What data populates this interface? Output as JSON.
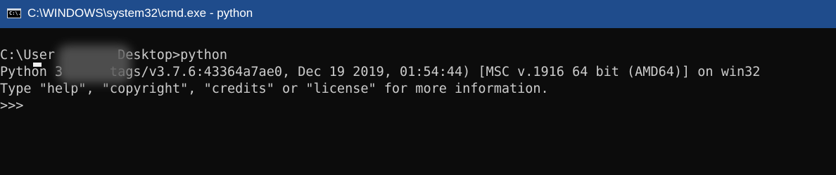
{
  "window": {
    "title": "C:\\WINDOWS\\system32\\cmd.exe - python",
    "icon_name": "cmd-icon",
    "icon_text": "C:\\.",
    "titlebar_color": "#1f4c8c",
    "background_color": "#0c0c0c",
    "text_color": "#cccccc"
  },
  "console": {
    "command_line": "C:\\User        Desktop>python",
    "banner_line": "Python 3      tags/v3.7.6:43364a7ae0, Dec 19 2019, 01:54:44) [MSC v.1916 64 bit (AMD64)] on win32",
    "info_line": "Type \"help\", \"copyright\", \"credits\" or \"license\" for more information.",
    "repl_prompt": ">>> "
  }
}
